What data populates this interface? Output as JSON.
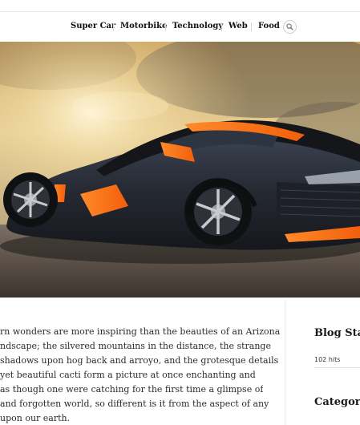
{
  "nav": {
    "items": [
      {
        "label": "Super Car"
      },
      {
        "label": "Motorbike"
      },
      {
        "label": "Technology"
      },
      {
        "label": "Web"
      },
      {
        "label": "Food"
      }
    ],
    "search_icon": "search-icon"
  },
  "hero": {
    "image": "sports-car-at-sunset"
  },
  "post": {
    "lines": [
      "rn wonders are more inspiring than the beauties of an Arizona",
      "ndscape; the silvered mountains in the distance, the strange",
      "shadows upon hog back and arroyo, and the grotesque details",
      "yet beautiful cacti form a picture at once enchanting and",
      "as though one were catching for the first time a glimpse of",
      "and forgotten world, so different is it from the aspect of any",
      "upon our earth."
    ]
  },
  "sidebar": {
    "blog_stats_title": "Blog Stat",
    "blog_stats_value": "102 hits",
    "categories_title": "Categori"
  }
}
